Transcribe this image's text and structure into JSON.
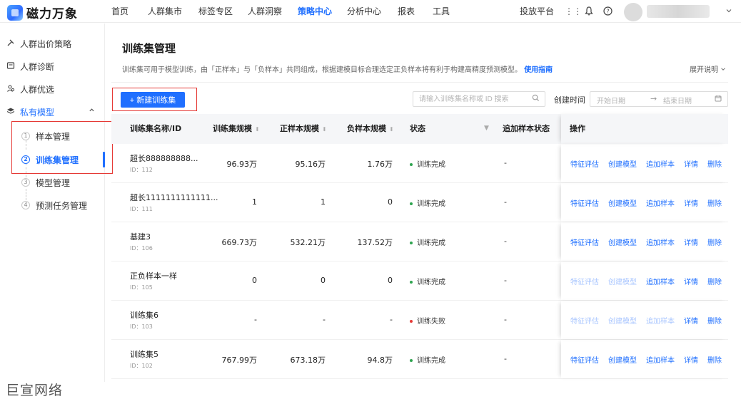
{
  "app": {
    "logo_text": "磁力万象"
  },
  "nav": {
    "items": [
      {
        "label": "首页",
        "active": false
      },
      {
        "label": "人群集市",
        "active": false
      },
      {
        "label": "标签专区",
        "active": false
      },
      {
        "label": "人群洞察",
        "active": false
      },
      {
        "label": "策略中心",
        "active": true
      },
      {
        "label": "分析中心",
        "active": false
      },
      {
        "label": "报表",
        "active": false
      },
      {
        "label": "工具",
        "active": false
      }
    ],
    "right_link": "投放平台"
  },
  "sidebar": {
    "items": [
      {
        "label": "人群出价策略",
        "icon": "bid-strategy-icon"
      },
      {
        "label": "人群诊断",
        "icon": "diagnosis-icon"
      },
      {
        "label": "人群优选",
        "icon": "people-icon"
      },
      {
        "label": "私有模型",
        "icon": "layers-icon"
      }
    ],
    "subitems": [
      {
        "num": "1",
        "label": "样本管理",
        "active": false
      },
      {
        "num": "2",
        "label": "训练集管理",
        "active": true
      },
      {
        "num": "3",
        "label": "模型管理",
        "active": false
      },
      {
        "num": "4",
        "label": "预测任务管理",
        "active": false
      }
    ],
    "watermark": "巨宣网络"
  },
  "main": {
    "title": "训练集管理",
    "desc": "训练集可用于模型训练，由「正样本」与「负样本」共同组成，根据建模目标合理选定正负样本将有利于构建高精度预测模型。",
    "guide_link": "使用指南",
    "expand_label": "展开说明",
    "new_button": "+ 新建训练集",
    "search_placeholder": "请输入训练集名称或 ID 搜索",
    "date_label": "创建时间",
    "date_start_placeholder": "开始日期",
    "date_end_placeholder": "结束日期"
  },
  "table": {
    "headers": [
      "训练集名称/ID",
      "训练集规模",
      "正样本规模",
      "负样本规模",
      "状态",
      "追加样本状态",
      "操作"
    ],
    "op_labels": [
      "特征评估",
      "创建模型",
      "追加样本",
      "详情",
      "删除"
    ],
    "rows": [
      {
        "name": "超长888888888...",
        "id": "ID：112",
        "size": "96.93万",
        "pos": "95.16万",
        "neg": "1.76万",
        "status": "训练完成",
        "status_color": "#2ea44f",
        "add_status": "-",
        "ops_disabled": [
          false,
          false,
          false,
          false,
          false
        ]
      },
      {
        "name": "超长1111111111111...",
        "id": "ID：111",
        "size": "1",
        "pos": "1",
        "neg": "0",
        "status": "训练完成",
        "status_color": "#2ea44f",
        "add_status": "-",
        "ops_disabled": [
          false,
          false,
          false,
          false,
          false
        ]
      },
      {
        "name": "基建3",
        "id": "ID：106",
        "size": "669.73万",
        "pos": "532.21万",
        "neg": "137.52万",
        "status": "训练完成",
        "status_color": "#2ea44f",
        "add_status": "-",
        "ops_disabled": [
          false,
          false,
          false,
          false,
          false
        ]
      },
      {
        "name": "正负样本一样",
        "id": "ID：105",
        "size": "0",
        "pos": "0",
        "neg": "0",
        "status": "训练完成",
        "status_color": "#2ea44f",
        "add_status": "-",
        "ops_disabled": [
          true,
          true,
          false,
          false,
          false
        ]
      },
      {
        "name": "训练集6",
        "id": "ID：103",
        "size": "-",
        "pos": "-",
        "neg": "-",
        "status": "训练失败",
        "status_color": "#e53935",
        "add_status": "-",
        "ops_disabled": [
          true,
          true,
          true,
          false,
          false
        ]
      },
      {
        "name": "训练集5",
        "id": "ID：102",
        "size": "767.99万",
        "pos": "673.18万",
        "neg": "94.8万",
        "status": "训练完成",
        "status_color": "#2ea44f",
        "add_status": "-",
        "ops_disabled": [
          false,
          false,
          false,
          false,
          false
        ]
      }
    ]
  }
}
